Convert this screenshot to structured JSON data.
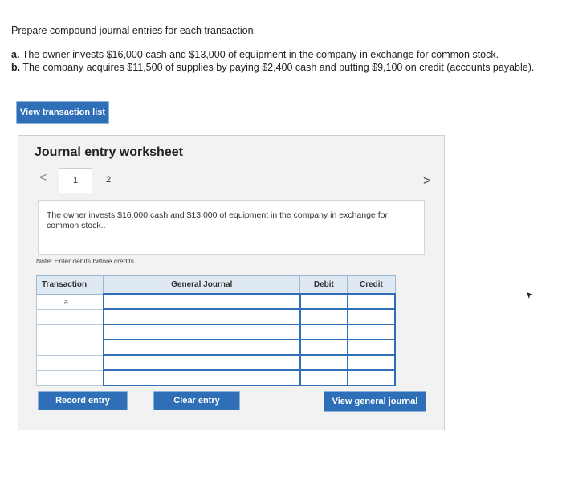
{
  "instructions": {
    "prompt": "Prepare compound journal entries for each transaction.",
    "items": [
      {
        "letter": "a.",
        "text": "The owner invests $16,000 cash and $13,000 of equipment in the company in exchange for common stock."
      },
      {
        "letter": "b.",
        "text": "The company acquires $11,500 of supplies by paying $2,400 cash and putting $9,100 on credit (accounts payable)."
      }
    ]
  },
  "buttons": {
    "view_transaction_list": "View transaction list",
    "record_entry": "Record entry",
    "clear_entry": "Clear entry",
    "view_general_journal": "View general journal"
  },
  "worksheet": {
    "title": "Journal entry worksheet",
    "prev_icon": "<",
    "next_icon": ">",
    "tabs": [
      {
        "label": "1",
        "active": true
      },
      {
        "label": "2",
        "active": false
      }
    ],
    "description": "The owner invests $16,000 cash and $13,000 of equipment in the company in exchange for common stock..",
    "note": "Note: Enter debits before credits.",
    "table": {
      "headers": {
        "transaction": "Transaction",
        "general_journal": "General Journal",
        "debit": "Debit",
        "credit": "Credit"
      },
      "rows": [
        {
          "transaction": "a."
        },
        {
          "transaction": ""
        },
        {
          "transaction": ""
        },
        {
          "transaction": ""
        },
        {
          "transaction": ""
        },
        {
          "transaction": ""
        }
      ]
    }
  },
  "colors": {
    "button_blue": "#2f6fb7",
    "header_blue": "#dfe9f4",
    "worksheet_bg": "#f2f2f2"
  }
}
